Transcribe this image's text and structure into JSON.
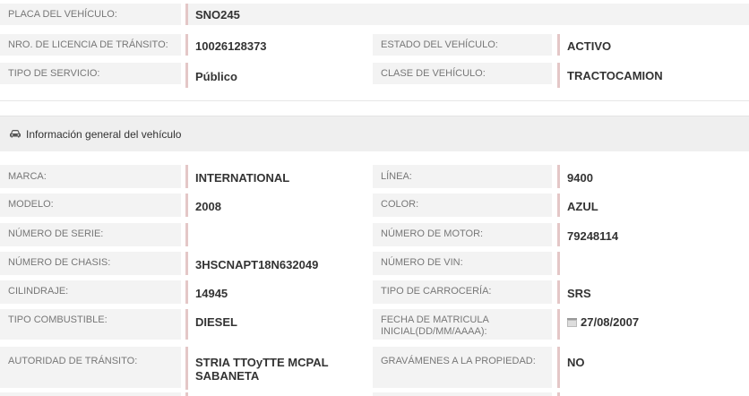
{
  "top": {
    "placa_label": "PLACA DEL VEHÍCULO:",
    "placa_value": "SNO245",
    "licencia_label": "NRO. DE LICENCIA DE TRÁNSITO:",
    "licencia_value": "10026128373",
    "estado_label": "ESTADO DEL VEHÍCULO:",
    "estado_value": "ACTIVO",
    "servicio_label": "TIPO DE SERVICIO:",
    "servicio_value": "Público",
    "clase_label": "CLASE DE VEHÍCULO:",
    "clase_value": "TRACTOCAMION"
  },
  "section": {
    "icon": "car-icon",
    "title": "Información general del vehículo"
  },
  "general": {
    "marca_label": "MARCA:",
    "marca_value": "INTERNATIONAL",
    "linea_label": "LÍNEA:",
    "linea_value": "9400",
    "modelo_label": "MODELO:",
    "modelo_value": "2008",
    "color_label": "COLOR:",
    "color_value": "AZUL",
    "serie_label": "NÚMERO DE SERIE:",
    "serie_value": "",
    "motor_label": "NÚMERO DE MOTOR:",
    "motor_value": "79248114",
    "chasis_label": "NÚMERO DE CHASIS:",
    "chasis_value": "3HSCNAPT18N632049",
    "vin_label": "NÚMERO DE VIN:",
    "vin_value": "",
    "cilindraje_label": "CILINDRAJE:",
    "cilindraje_value": "14945",
    "carroceria_label": "TIPO DE CARROCERÍA:",
    "carroceria_value": "SRS",
    "combustible_label": "TIPO COMBUSTIBLE:",
    "combustible_value": "DIESEL",
    "matricula_label": "FECHA DE MATRICULA INICIAL(DD/MM/AAAA):",
    "matricula_value": "27/08/2007",
    "autoridad_label": "AUTORIDAD DE TRÁNSITO:",
    "autoridad_value": "STRIA TTOyTTE MCPAL SABANETA",
    "gravamenes_label": "GRAVÁMENES A LA PROPIEDAD:",
    "gravamenes_value": "NO"
  },
  "colors": {
    "label_bg": "#f3f3f3",
    "value_border": "#e4c7c7",
    "section_bg": "#efefef"
  }
}
